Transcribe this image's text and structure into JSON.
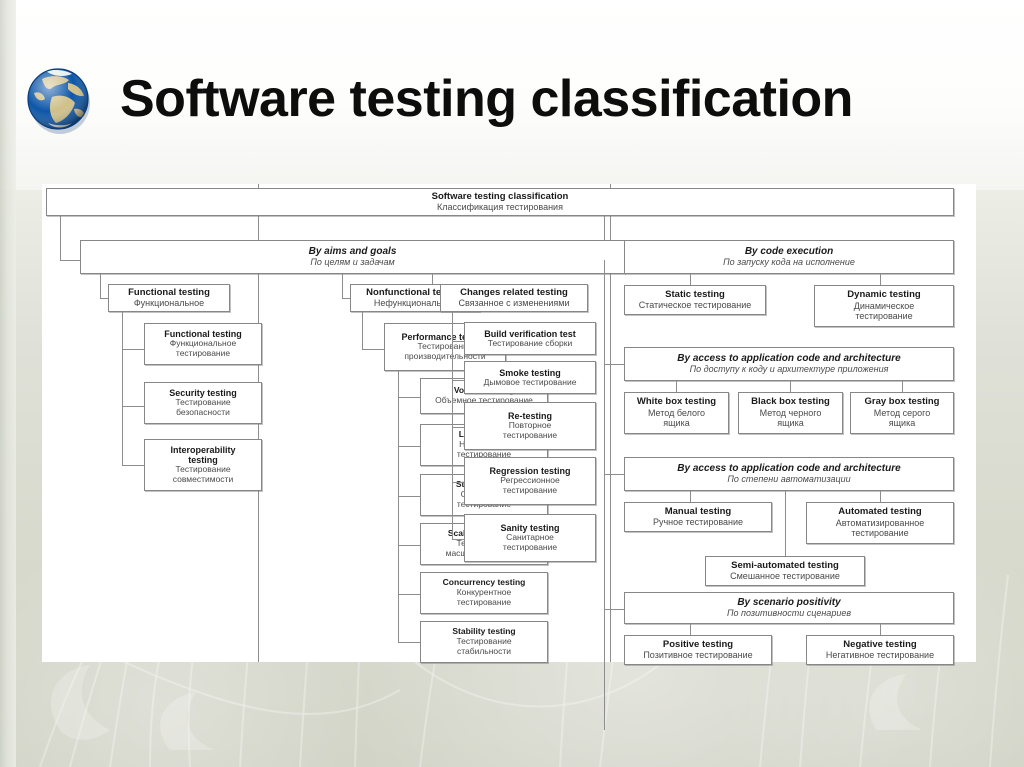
{
  "slide": {
    "title": "Software testing classification",
    "globe_icon": "globe-icon"
  },
  "diagram": {
    "root": {
      "en": "Software testing classification",
      "ru": "Классификация тестирования"
    },
    "groups": [
      {
        "en": "By aims and goals",
        "ru": "По целям и задачам"
      },
      {
        "en": "By code execution",
        "ru": "По запуску кода на исполнение"
      },
      {
        "en": "By access to application code and architecture",
        "ru": "По доступу к коду и архитектуре приложения"
      },
      {
        "en": "By access to application code and architecture",
        "ru": "По степени автоматизации"
      },
      {
        "en": "By scenario positivity",
        "ru": "По позитивности сценариев"
      }
    ],
    "nodes": {
      "functional": {
        "en": "Functional testing",
        "ru": "Функциональное"
      },
      "nonfunctional": {
        "en": "Nonfunctional testing",
        "ru": "Нефункциональное"
      },
      "changes": {
        "en": "Changes related testing",
        "ru": "Связанное с изменениями"
      },
      "functional_sub": {
        "en": "Functional testing",
        "ru": "Функциональное\nтестирование"
      },
      "security": {
        "en": "Security testing",
        "ru": "Тестирование\nбезопасности"
      },
      "interoperability": {
        "en": "Interoperability\ntesting",
        "ru": "Тестирование\nсовместимости"
      },
      "performance": {
        "en": "Performance testing",
        "ru": "Тестирование\nпроизводительности"
      },
      "volume": {
        "en": "Volume testing",
        "ru": "Объемное тестирование"
      },
      "load": {
        "en": "Load testing",
        "ru": "Нагрузочное\nтестирование"
      },
      "stress": {
        "en": "Stress testing",
        "ru": "Стрессовое\nтестирование"
      },
      "scalability": {
        "en": "Scalability testing",
        "ru": "Тестирование\nмасштабируемости"
      },
      "concurrency": {
        "en": "Concurrency testing",
        "ru": "Конкурентное\nтестирование"
      },
      "stability": {
        "en": "Stability testing",
        "ru": "Тестирование\nстабильности"
      },
      "build_verification": {
        "en": "Build verification test",
        "ru": "Тестирование сборки"
      },
      "smoke": {
        "en": "Smoke testing",
        "ru": "Дымовое тестирование"
      },
      "retesting": {
        "en": "Re-testing",
        "ru": "Повторное\nтестирование"
      },
      "regression": {
        "en": "Regression testing",
        "ru": "Регрессионное\nтестирование"
      },
      "sanity": {
        "en": "Sanity testing",
        "ru": "Санитарное\nтестирование"
      },
      "static": {
        "en": "Static testing",
        "ru": "Статическое тестирование"
      },
      "dynamic": {
        "en": "Dynamic testing",
        "ru": "Динамическое\nтестирование"
      },
      "white_box": {
        "en": "White box testing",
        "ru": "Метод белого\nящика"
      },
      "black_box": {
        "en": "Black box testing",
        "ru": "Метод черного\nящика"
      },
      "gray_box": {
        "en": "Gray box testing",
        "ru": "Метод серого\nящика"
      },
      "manual": {
        "en": "Manual testing",
        "ru": "Ручное тестирование"
      },
      "automated": {
        "en": "Automated testing",
        "ru": "Автоматизированное\nтестирование"
      },
      "semi_automated": {
        "en": "Semi-automated testing",
        "ru": "Смешанное тестирование"
      },
      "positive": {
        "en": "Positive testing",
        "ru": "Позитивное тестирование"
      },
      "negative": {
        "en": "Negative testing",
        "ru": "Негативное тестирование"
      }
    },
    "colors": {
      "box_border": "#878787",
      "connector": "#8d8d8d",
      "panel_bg": "#ffffff",
      "ru_text": "#4a4a4a",
      "en_text": "#1a1a1a"
    }
  }
}
